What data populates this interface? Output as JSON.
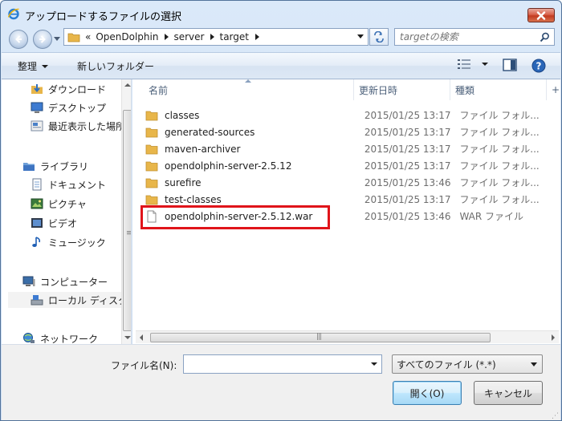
{
  "window": {
    "title": "アップロードするファイルの選択"
  },
  "address": {
    "chevrons": "«",
    "crumbs": [
      "OpenDolphin",
      "server",
      "target"
    ]
  },
  "search": {
    "placeholder": "targetの検索"
  },
  "toolbar": {
    "organize_label": "整理",
    "new_folder_label": "新しいフォルダー"
  },
  "nav": {
    "items": [
      {
        "label": "ダウンロード",
        "icon": "download-folder-icon"
      },
      {
        "label": "デスクトップ",
        "icon": "desktop-icon"
      },
      {
        "label": "最近表示した場所",
        "icon": "recent-places-icon"
      },
      {
        "label": "ライブラリ",
        "icon": "library-icon"
      },
      {
        "label": "ドキュメント",
        "icon": "documents-icon"
      },
      {
        "label": "ピクチャ",
        "icon": "pictures-icon"
      },
      {
        "label": "ビデオ",
        "icon": "videos-icon"
      },
      {
        "label": "ミュージック",
        "icon": "music-icon"
      },
      {
        "label": "コンピューター",
        "icon": "computer-icon"
      },
      {
        "label": "ローカル ディスク",
        "icon": "local-disk-icon"
      },
      {
        "label": "ネットワーク",
        "icon": "network-icon"
      }
    ]
  },
  "file_list": {
    "columns": [
      "名前",
      "更新日時",
      "種類"
    ],
    "files": [
      {
        "name": "classes",
        "date": "2015/01/25 13:17",
        "type": "ファイル フォル...",
        "kind": "folder"
      },
      {
        "name": "generated-sources",
        "date": "2015/01/25 13:17",
        "type": "ファイル フォル...",
        "kind": "folder"
      },
      {
        "name": "maven-archiver",
        "date": "2015/01/25 13:17",
        "type": "ファイル フォル...",
        "kind": "folder"
      },
      {
        "name": "opendolphin-server-2.5.12",
        "date": "2015/01/25 13:17",
        "type": "ファイル フォル...",
        "kind": "folder"
      },
      {
        "name": "surefire",
        "date": "2015/01/25 13:46",
        "type": "ファイル フォル...",
        "kind": "folder"
      },
      {
        "name": "test-classes",
        "date": "2015/01/25 13:17",
        "type": "ファイル フォル...",
        "kind": "folder"
      },
      {
        "name": "opendolphin-server-2.5.12.war",
        "date": "2015/01/25 13:46",
        "type": "WAR ファイル",
        "kind": "file"
      }
    ]
  },
  "bottom": {
    "filename_label": "ファイル名(N):",
    "filename_value": "",
    "filter_value": "すべてのファイル (*.*)",
    "open_label": "開く(O)",
    "cancel_label": "キャンセル"
  },
  "colors": {
    "highlight_box": "#e0141a",
    "folder": "#e8b64a",
    "close_button": "#c23b21"
  }
}
